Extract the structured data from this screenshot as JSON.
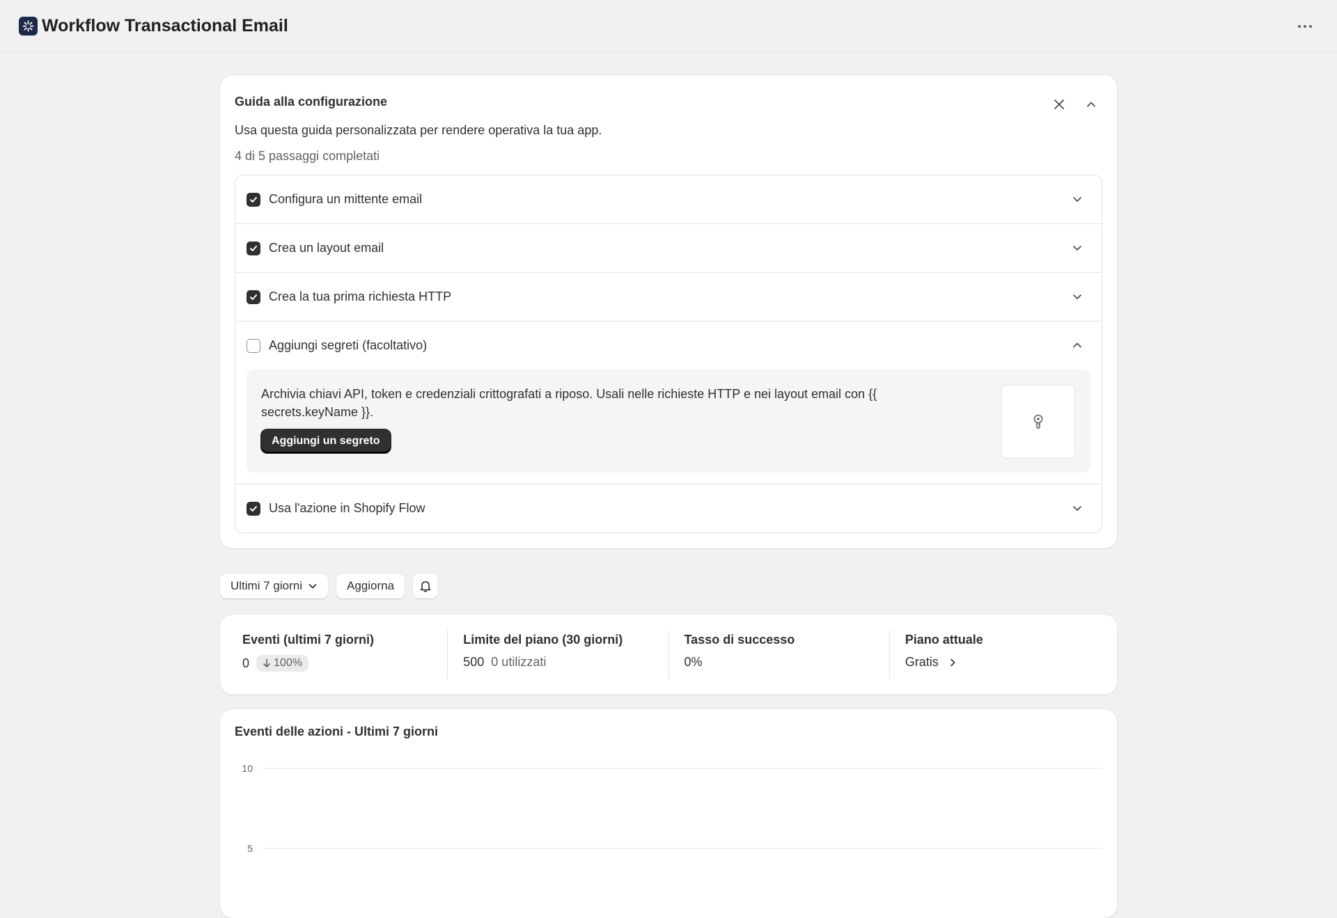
{
  "app": {
    "title": "Workflow Transactional Email"
  },
  "guide": {
    "title": "Guida alla configurazione",
    "description": "Usa questa guida personalizzata per rendere operativa la tua app.",
    "progress": "4 di 5 passaggi completati",
    "steps": [
      {
        "label": "Configura un mittente email",
        "checked": true
      },
      {
        "label": "Crea un layout email",
        "checked": true
      },
      {
        "label": "Crea la tua prima richiesta HTTP",
        "checked": true
      },
      {
        "label": "Aggiungi segreti (facoltativo)",
        "checked": false,
        "expanded": true,
        "body": "Archivia chiavi API, token e credenziali crittografati a riposo. Usali nelle richieste HTTP e nei layout email con {{ secrets.keyName }}.",
        "button": "Aggiungi un segreto"
      },
      {
        "label": "Usa l'azione in Shopify Flow",
        "checked": true
      }
    ]
  },
  "toolbar": {
    "range_label": "Ultimi 7 giorni",
    "refresh_label": "Aggiorna"
  },
  "stats": [
    {
      "label": "Eventi (ultimi 7 giorni)",
      "value": "0",
      "badge": "100%"
    },
    {
      "label": "Limite del piano (30 giorni)",
      "value": "500",
      "secondary": "0 utilizzati"
    },
    {
      "label": "Tasso di successo",
      "value": "0%"
    },
    {
      "label": "Piano attuale",
      "value": "Gratis"
    }
  ],
  "chart_data": {
    "type": "line",
    "title": "Eventi delle azioni - Ultimi 7 giorni",
    "y_ticks": [
      "10",
      "5"
    ],
    "ylim": [
      0,
      10
    ],
    "grid": true
  },
  "colors": {
    "accent": "#303030",
    "logo_bg": "#1c2a4a"
  }
}
